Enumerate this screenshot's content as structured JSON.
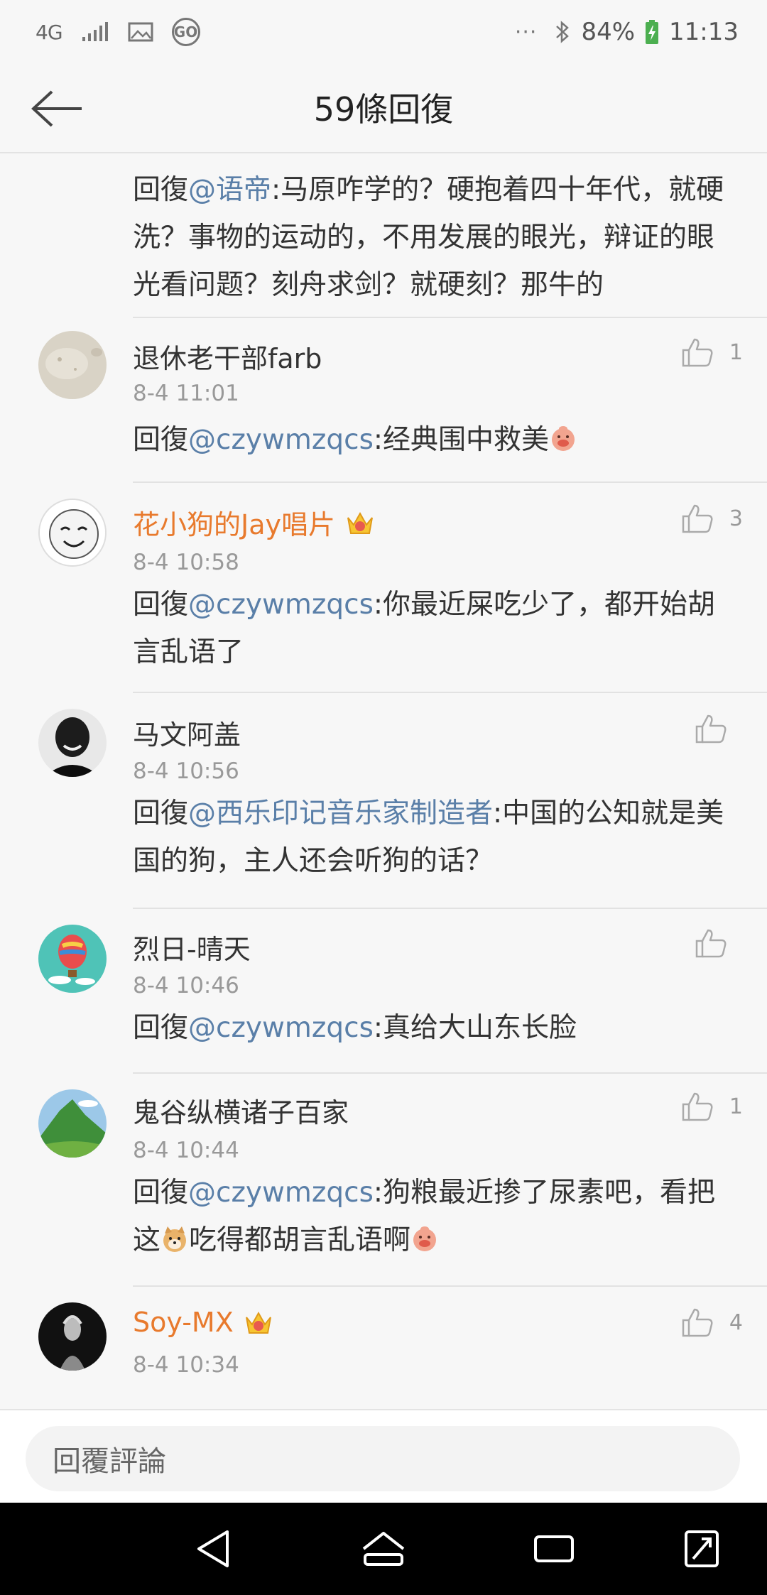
{
  "status_bar": {
    "network": "4G",
    "battery": "84%",
    "time": "11:13",
    "dots": "···",
    "go": "GO"
  },
  "header": {
    "title": "59條回復"
  },
  "partial_reply": {
    "prefix": "回復",
    "mention": "@语帝",
    "text": ":马原咋学的？硬抱着四十年代，就硬洗？事物的运动的，不用发展的眼光，辩证的眼光看问题？刻舟求剑？就硬刻？那牛的"
  },
  "comments": [
    {
      "username": "退休老干部farb",
      "timestamp": "8-4 11:01",
      "likes": "1",
      "prefix": "回復",
      "mention": "@czywmzqcs",
      "text": ":经典围中救美",
      "text_after": ""
    },
    {
      "username": "花小狗的Jay唱片",
      "timestamp": "8-4 10:58",
      "likes": "3",
      "prefix": "回復",
      "mention": "@czywmzqcs",
      "text": ":你最近屎吃少了，都开始胡言乱语了",
      "text_after": ""
    },
    {
      "username": "马文阿盖",
      "timestamp": "8-4 10:56",
      "likes": "",
      "prefix": "回復",
      "mention": "@西乐印记音乐家制造者",
      "text": ":中国的公知就是美国的狗，主人还会听狗的话？",
      "text_after": ""
    },
    {
      "username": "烈日-晴天",
      "timestamp": "8-4 10:46",
      "likes": "",
      "prefix": "回復",
      "mention": "@czywmzqcs",
      "text": ":真给大山东长脸",
      "text_after": ""
    },
    {
      "username": "鬼谷纵横诸子百家",
      "timestamp": "8-4 10:44",
      "likes": "1",
      "prefix": "回復",
      "mention": "@czywmzqcs",
      "text": ":狗粮最近掺了尿素吧，看把这",
      "text_after": "吃得都胡言乱语啊"
    },
    {
      "username": "Soy-MX",
      "timestamp": "8-4 10:34",
      "likes": "4",
      "prefix": "",
      "mention": "",
      "text": "",
      "text_after": ""
    }
  ],
  "reply_box": {
    "placeholder": "回覆評論"
  },
  "colors": {
    "mention": "#5a7fa8",
    "vip_name": "#e87a2d",
    "background": "#f7f7f7"
  }
}
